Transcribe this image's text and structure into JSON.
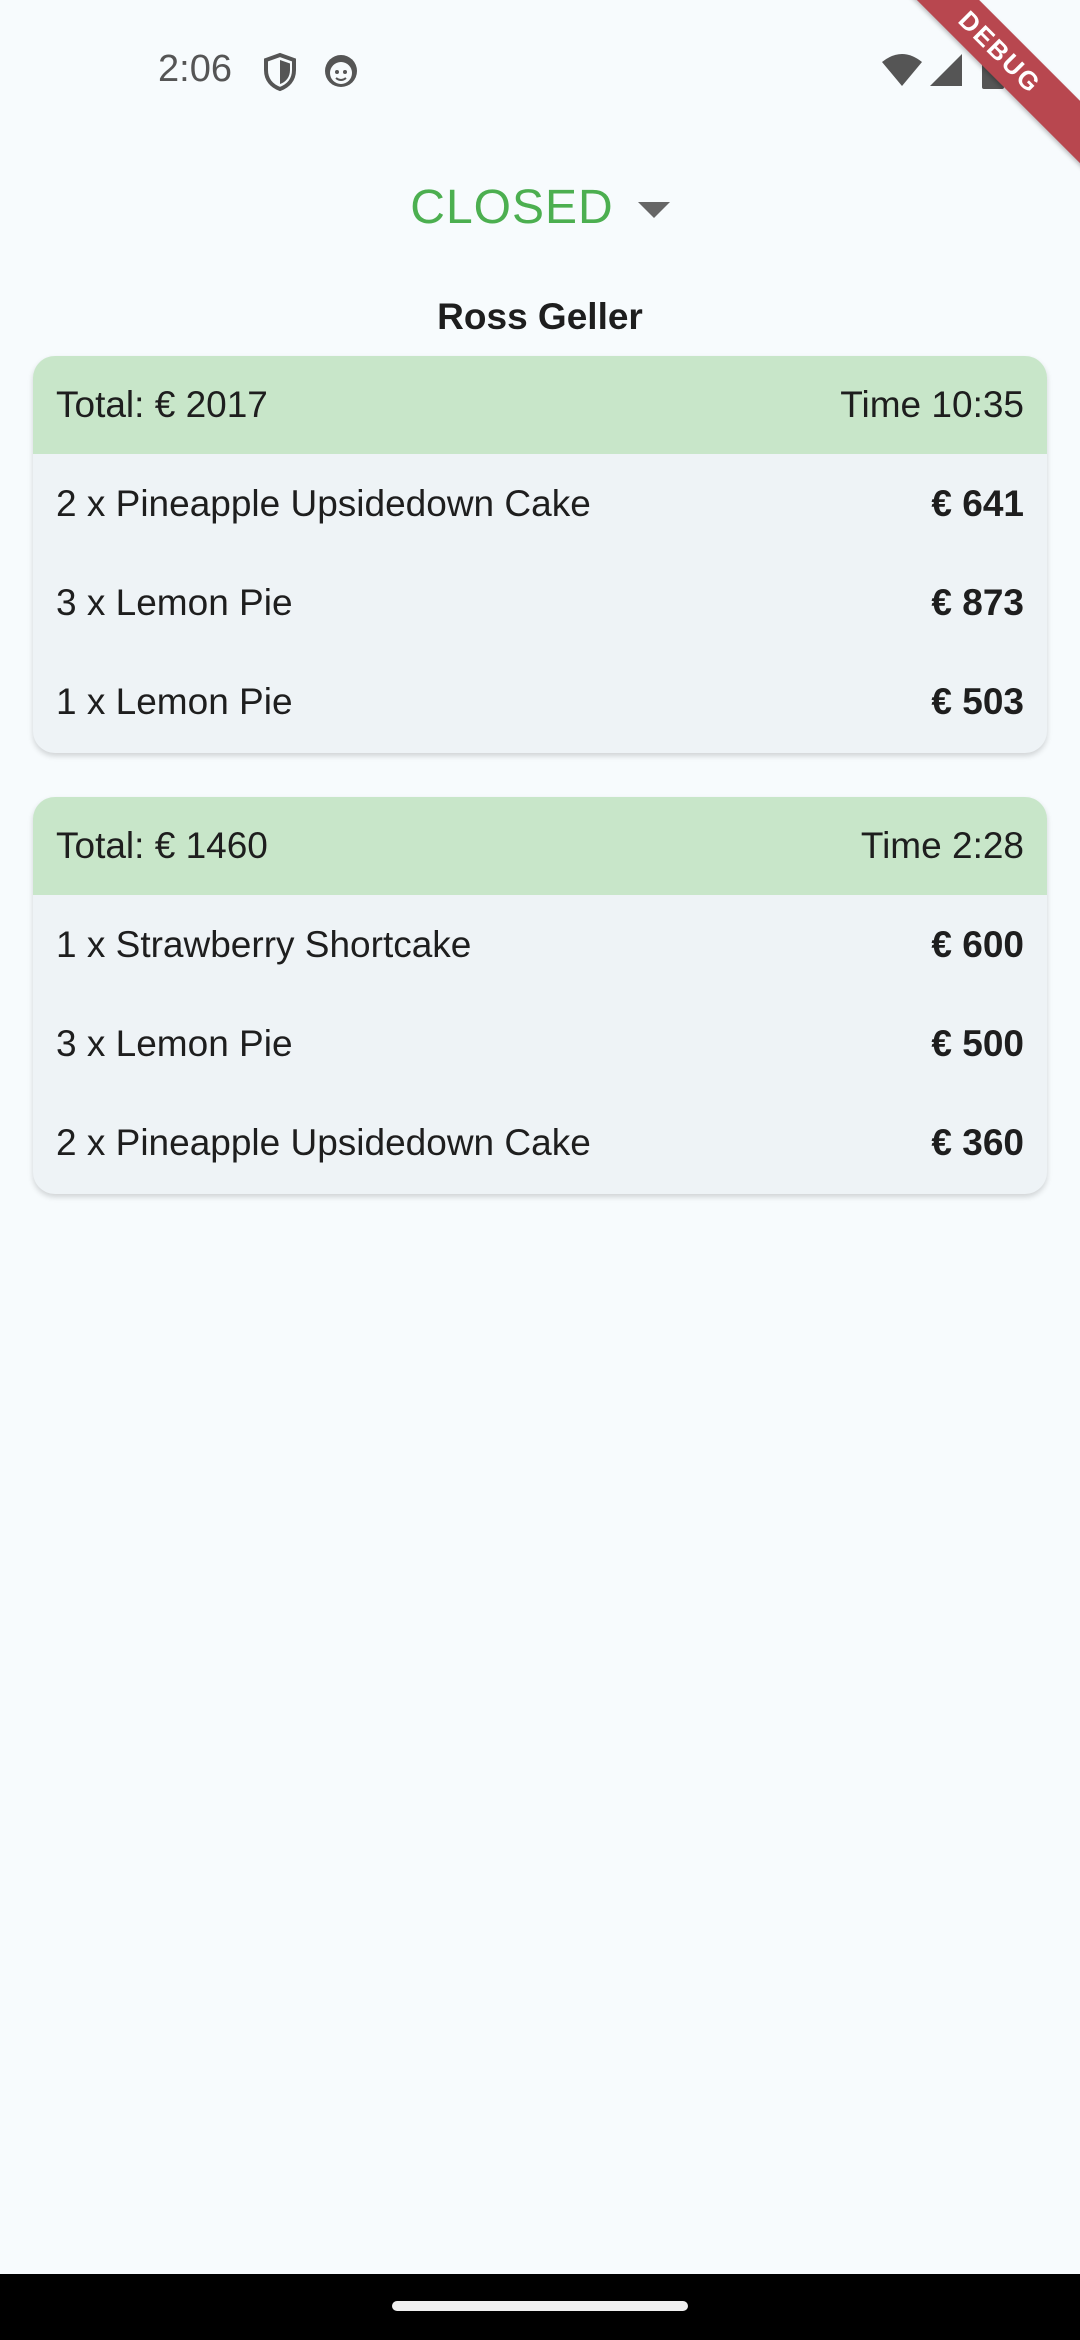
{
  "status_bar": {
    "time": "2:06",
    "debug_label": "DEBUG"
  },
  "status_filter": {
    "selected": "CLOSED"
  },
  "customer": {
    "name": "Ross Geller"
  },
  "orders": [
    {
      "total": "Total: € 2017",
      "time": "Time 10:35",
      "items": [
        {
          "label": "2 x Pineapple Upsidedown Cake",
          "price": "€ 641"
        },
        {
          "label": "3 x Lemon Pie",
          "price": "€ 873"
        },
        {
          "label": "1 x Lemon Pie",
          "price": "€ 503"
        }
      ]
    },
    {
      "total": "Total: € 1460",
      "time": "Time 2:28",
      "items": [
        {
          "label": "1 x Strawberry Shortcake",
          "price": "€ 600"
        },
        {
          "label": "3 x Lemon Pie",
          "price": "€ 500"
        },
        {
          "label": "2 x Pineapple Upsidedown Cake",
          "price": "€ 360"
        }
      ]
    }
  ],
  "colors": {
    "accent_green": "#4caf50",
    "card_header": "#c8e6c9",
    "card_body": "#eef3f6",
    "debug_ribbon": "#b8474f"
  },
  "icons": {
    "status_left": [
      "shield-icon",
      "face-icon"
    ],
    "status_right": [
      "wifi-icon",
      "signal-icon",
      "battery-icon"
    ]
  }
}
